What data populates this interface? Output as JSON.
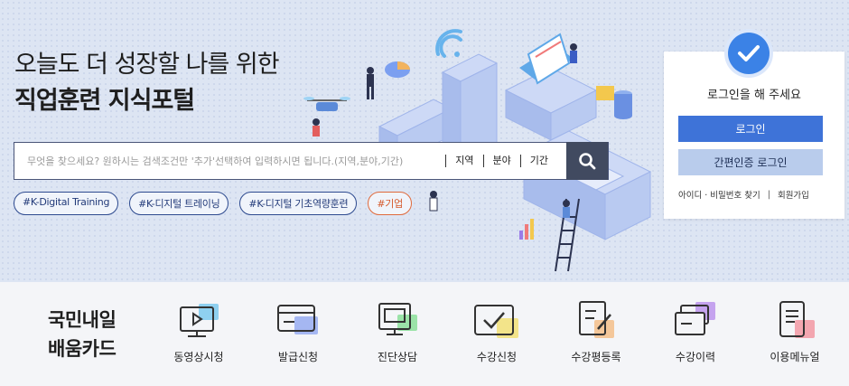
{
  "hero": {
    "headline_line1": "오늘도 더 성장할 나를 위한",
    "headline_line2": "직업훈련 지식포털"
  },
  "search": {
    "placeholder": "무엇을 찾으세요? 원하시는 검색조건만 '추가'선택하여 입력하시면 됩니다.(지역,분야,기간)",
    "filters": [
      "지역",
      "분야",
      "기간"
    ],
    "button_icon": "search-icon"
  },
  "tags": [
    {
      "label": "#K-Digital Training",
      "color": "#2d4a8f"
    },
    {
      "label": "#K-디지털 트레이닝",
      "color": "#2d4a8f"
    },
    {
      "label": "#K-디지털 기초역량훈련",
      "color": "#2d4a8f"
    },
    {
      "label": "#기업",
      "color": "#e06a3c"
    }
  ],
  "login": {
    "message": "로그인을 해 주세요",
    "login_button": "로그인",
    "easy_login_button": "간편인증 로그인",
    "find_link": "아이디 · 비밀번호 찾기",
    "separator": "|",
    "signup_link": "회원가입",
    "accent": "#3e73d8"
  },
  "card": {
    "title_line1": "국민내일",
    "title_line2": "배움카드"
  },
  "menu": [
    {
      "label": "동영상시청",
      "icon": "video-monitor-icon",
      "accent": "#8fd0f0"
    },
    {
      "label": "발급신청",
      "icon": "card-icon",
      "accent": "#a5b7f2"
    },
    {
      "label": "진단상담",
      "icon": "chat-monitor-icon",
      "accent": "#9be3a8"
    },
    {
      "label": "수강신청",
      "icon": "checkbox-icon",
      "accent": "#f3e48a"
    },
    {
      "label": "수강평등록",
      "icon": "document-pen-icon",
      "accent": "#f4c79a"
    },
    {
      "label": "수강이력",
      "icon": "cards-history-icon",
      "accent": "#c5a3ef"
    },
    {
      "label": "이용메뉴얼",
      "icon": "manual-book-icon",
      "accent": "#f3a6b0"
    }
  ]
}
